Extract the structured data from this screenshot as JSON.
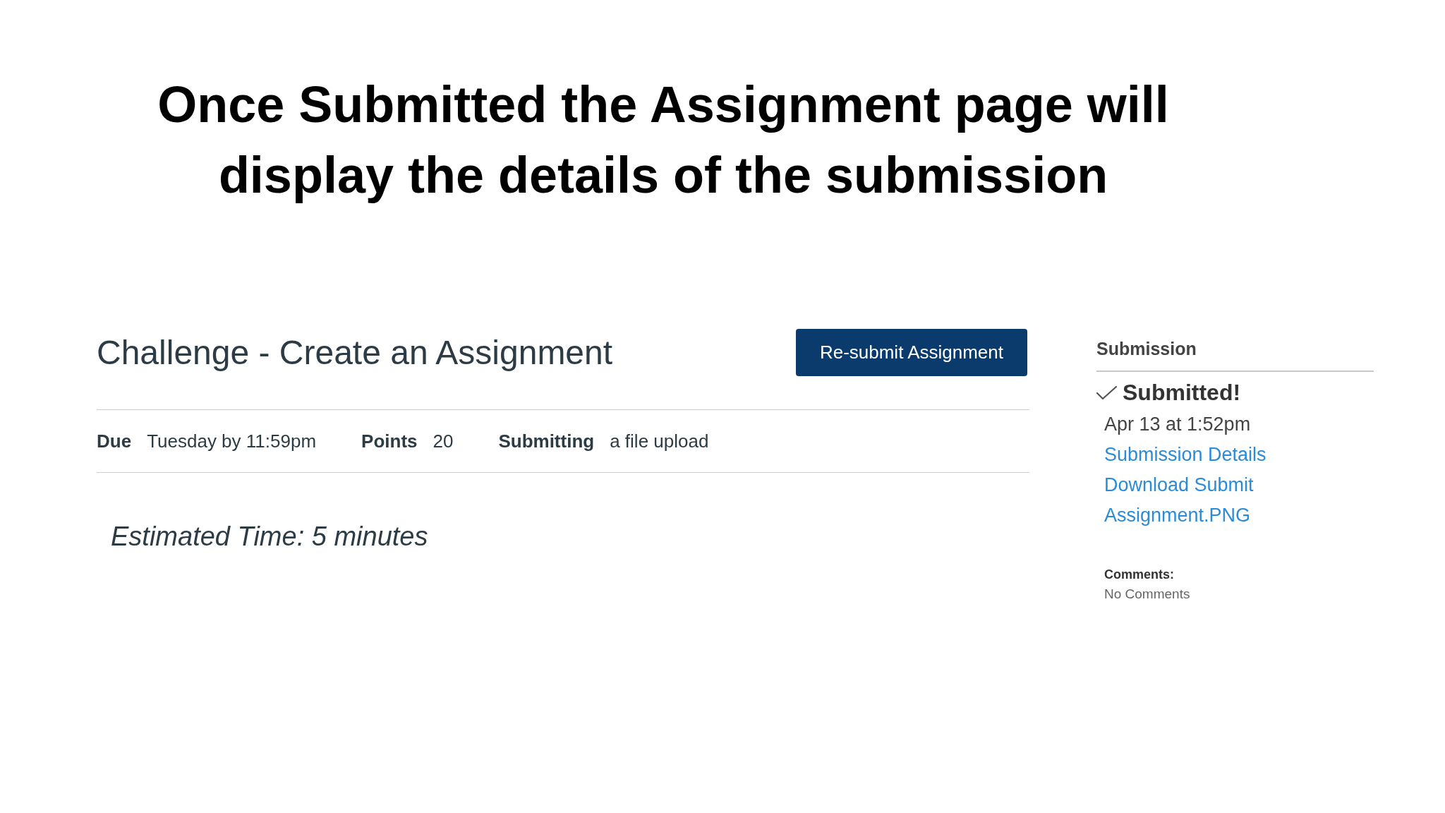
{
  "slide_title": "Once Submitted the Assignment page will display the details of the submission",
  "assignment": {
    "title": "Challenge - Create an Assignment",
    "resubmit_button": "Re-submit Assignment",
    "details": [
      {
        "label": "Due",
        "value": "Tuesday by 11:59pm"
      },
      {
        "label": "Points",
        "value": "20"
      },
      {
        "label": "Submitting",
        "value": "a file upload"
      }
    ],
    "estimated_time": "Estimated Time: 5 minutes"
  },
  "submission_sidebar": {
    "heading": "Submission",
    "status": "Submitted!",
    "submitted_at": "Apr 13 at 1:52pm",
    "links": [
      "Submission Details",
      "Download Submit Assignment.PNG"
    ],
    "comments_label": "Comments:",
    "comments": "No Comments"
  }
}
